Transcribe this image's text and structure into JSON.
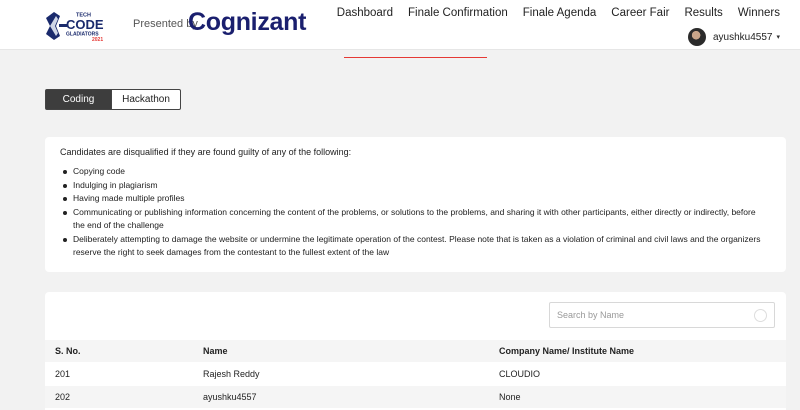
{
  "header": {
    "logo": {
      "small_top": "TECH",
      "main": "CODE",
      "sub": "GLADIATORS",
      "year": "2021"
    },
    "presented_by": "Presented by",
    "sponsor": "Cognizant",
    "nav": [
      "Dashboard",
      "Finale Confirmation",
      "Finale Agenda",
      "Career Fair",
      "Results",
      "Winners"
    ],
    "user": {
      "name": "ayushku4557",
      "caret": "▾"
    }
  },
  "tabs": [
    {
      "label": "Coding",
      "active": true
    },
    {
      "label": "Hackathon",
      "active": false
    }
  ],
  "rules": {
    "heading": "Candidates are disqualified if they are found guilty of any of the following:",
    "items": [
      "Copying code",
      "Indulging in plagiarism",
      "Having made multiple profiles",
      "Communicating or publishing information concerning the content of the problems, or solutions to the problems, and sharing it with other participants, either directly or indirectly, before the end of the challenge",
      "Deliberately attempting to damage the website or undermine the legitimate operation of the contest. Please note that is taken as a violation of criminal and civil laws and the organizers reserve the right to seek damages from the contestant to the fullest extent of the law"
    ]
  },
  "search": {
    "placeholder": "Search by Name",
    "value": ""
  },
  "table": {
    "headers": [
      "S. No.",
      "Name",
      "Company Name/ Institute Name"
    ],
    "rows": [
      [
        "201",
        "Rajesh Reddy",
        "CLOUDIO"
      ],
      [
        "202",
        "ayushku4557",
        "None"
      ]
    ]
  },
  "colors": {
    "accent_line": "#e53935",
    "brand_navy": "#1a1f6e",
    "active_tab": "#3d3d3d",
    "page_bg": "#f2f2f2"
  }
}
